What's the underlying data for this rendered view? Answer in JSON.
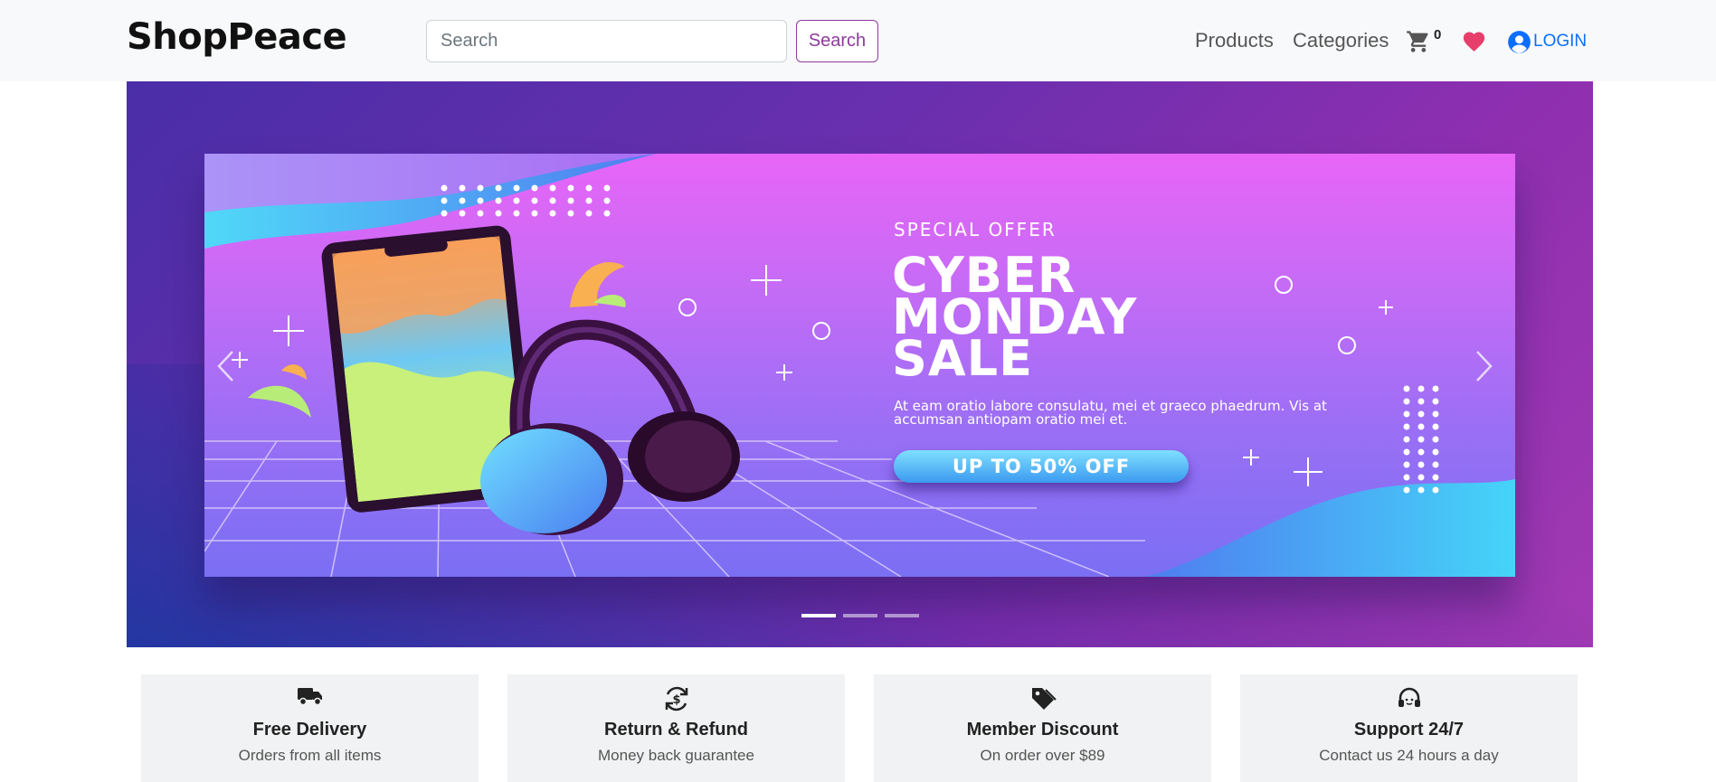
{
  "brand": "ShopPeace",
  "search": {
    "placeholder": "Search",
    "button_label": "Search"
  },
  "nav": {
    "products_label": "Products",
    "categories_label": "Categories",
    "cart_count": "0",
    "login_label": "LOGIN"
  },
  "banner": {
    "eyebrow": "SPECIAL OFFER",
    "title": "CYBER\nMONDAY\nSALE",
    "subtitle": "At eam oratio labore consulatu, mei et graeco phaedrum. Vis at accumsan antiopam oratio mei et.",
    "cta": "UP TO 50% OFF"
  },
  "carousel": {
    "slide_count": 3,
    "active_slide": 1
  },
  "features": [
    {
      "icon": "truck-icon",
      "title": "Free Delivery",
      "subtitle": "Orders from all items"
    },
    {
      "icon": "refund-icon",
      "title": "Return & Refund",
      "subtitle": "Money back guarantee"
    },
    {
      "icon": "tag-icon",
      "title": "Member Discount",
      "subtitle": "On order over $89"
    },
    {
      "icon": "headset-icon",
      "title": "Support 24/7",
      "subtitle": "Contact us 24 hours a day"
    }
  ],
  "colors": {
    "navbar_bg": "#f8f9fa",
    "accent": "#8e3a9d",
    "link_blue": "#0d6efd",
    "heart": "#e83e6c",
    "feature_bg": "#f1f2f3"
  }
}
